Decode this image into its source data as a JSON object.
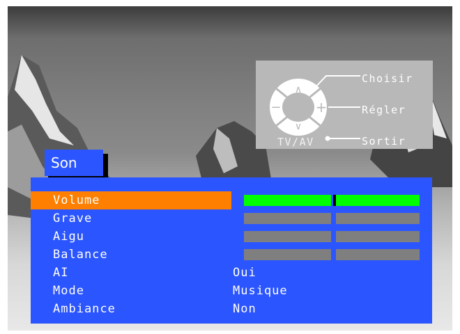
{
  "remote_help": {
    "choisir": "Choisir",
    "regler": "Régler",
    "sortir": "Sortir",
    "tvav": "TV/AV",
    "up_symbol": "∧",
    "down_symbol": "∨",
    "minus_symbol": "−",
    "plus_symbol": "+"
  },
  "menu": {
    "title": "Son",
    "items": [
      {
        "label": "Volume",
        "selected": true,
        "control": "bar",
        "level_percent": 52
      },
      {
        "label": "Grave",
        "control": "bar",
        "level_percent": 50
      },
      {
        "label": "Aigu",
        "control": "bar",
        "level_percent": 50
      },
      {
        "label": "Balance",
        "control": "bar",
        "level_percent": 50
      },
      {
        "label": "AI",
        "control": "text",
        "value": "Oui"
      },
      {
        "label": "Mode",
        "control": "text",
        "value": "Musique"
      },
      {
        "label": "Ambiance",
        "control": "text",
        "value": "Non"
      }
    ]
  },
  "colors": {
    "menu_blue": "#2b55ff",
    "selected_orange": "#ff7f00",
    "active_bar_green": "#00ff00",
    "inactive_bar_gray": "#7f7f7f"
  }
}
